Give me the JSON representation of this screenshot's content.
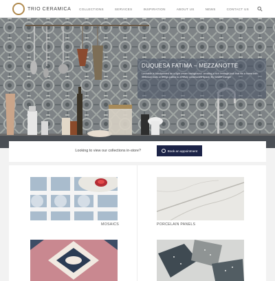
{
  "header": {
    "logo_text": "TRIO CERAMICA",
    "nav": [
      "COLLECTIONS",
      "SERVICES",
      "INSPIRATION",
      "ABOUT US",
      "NEWS",
      "CONTACT US"
    ],
    "search_icon": "search-icon",
    "brand_color": "#b08a4e"
  },
  "hero": {
    "title": "DUQUESA FATIMA – MEZZANOTTE",
    "description": "Lachable is handpainted on a light cream background, creating a rich heritage look that fits a home with historical roots or brings patina to a newly constructed space. By Walker Zanger"
  },
  "appointment": {
    "prompt": "Looking to view our collections in-store?",
    "button_label": "Book an appointment",
    "button_color": "#1c2347"
  },
  "collections": [
    {
      "label": "MOSAICS"
    },
    {
      "label": "PORCELAIN PANELS"
    },
    {
      "label": ""
    },
    {
      "label": ""
    }
  ]
}
